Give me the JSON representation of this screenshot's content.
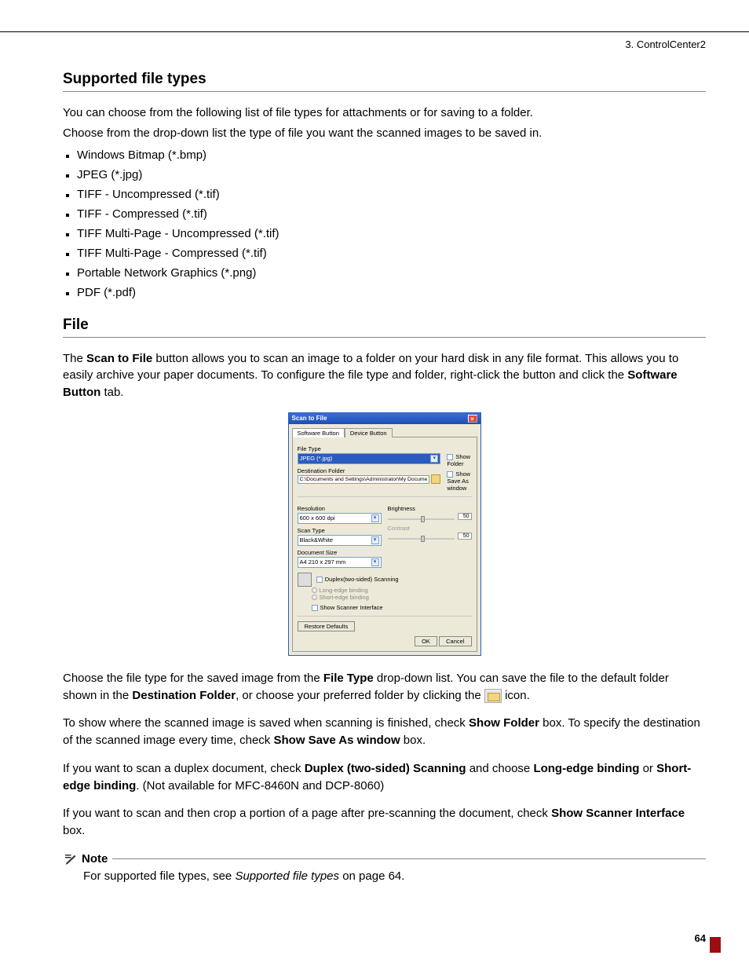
{
  "header": {
    "breadcrumb": "3. ControlCenter2"
  },
  "section1": {
    "title": "Supported file types",
    "intro1": "You can choose from the following list of file types for attachments or for saving to a folder.",
    "intro2": "Choose from the drop-down list the type of file you want the scanned images to be saved in.",
    "types": [
      "Windows Bitmap (*.bmp)",
      "JPEG (*.jpg)",
      "TIFF - Uncompressed (*.tif)",
      "TIFF - Compressed (*.tif)",
      "TIFF Multi-Page - Uncompressed (*.tif)",
      "TIFF Multi-Page - Compressed (*.tif)",
      "Portable Network Graphics (*.png)",
      "PDF (*.pdf)"
    ]
  },
  "section2": {
    "title": "File",
    "p1a": "The ",
    "p1b": "Scan to File",
    "p1c": " button allows you to scan an image to a folder on your hard disk in any file format. This allows you to easily archive your paper documents. To configure the file type and folder, right-click the button and click the ",
    "p1d": "Software Button",
    "p1e": " tab.",
    "p2a": "Choose the file type for the saved image from the ",
    "p2b": "File Type",
    "p2c": " drop-down list. You can save the file to the default folder shown in the ",
    "p2d": "Destination Folder",
    "p2e": ", or choose your preferred folder by clicking the ",
    "p2f": " icon.",
    "p3a": "To show where the scanned image is saved when scanning is finished, check ",
    "p3b": "Show Folder",
    "p3c": " box. To specify the destination of the scanned image every time, check ",
    "p3d": "Show Save As window",
    "p3e": " box.",
    "p4a": "If you want to scan a duplex document, check ",
    "p4b": "Duplex (two-sided) Scanning",
    "p4c": " and choose ",
    "p4d": "Long-edge binding",
    "p4e": " or ",
    "p4f": "Short-edge binding",
    "p4g": ". (Not available for MFC-8460N and DCP-8060)",
    "p5a": "If you want to scan and then crop a portion of a page after pre-scanning the document, check ",
    "p5b": "Show Scanner Interface",
    "p5c": " box."
  },
  "dialog": {
    "title": "Scan to File",
    "tab1": "Software Button",
    "tab2": "Device Button",
    "fileTypeLabel": "File Type",
    "fileType": "JPEG (*.jpg)",
    "destLabel": "Destination Folder",
    "dest": "C:\\Documents and Settings\\Administrator\\My Docume",
    "showFolder": "Show Folder",
    "showSaveAs": "Show Save As window",
    "resLabel": "Resolution",
    "res": "600 x 600 dpi",
    "scanTypeLabel": "Scan Type",
    "scanType": "Black&White",
    "docSizeLabel": "Document Size",
    "docSize": "A4 210 x 297 mm",
    "brightLabel": "Brightness",
    "brightVal": "50",
    "contrastLabel": "Contrast",
    "contrastVal": "50",
    "duplex": "Duplex(two-sided) Scanning",
    "longEdge": "Long-edge binding",
    "shortEdge": "Short-edge binding",
    "showScanner": "Show Scanner Interface",
    "restore": "Restore Defaults",
    "ok": "OK",
    "cancel": "Cancel"
  },
  "note": {
    "label": "Note",
    "t1": "For supported file types, see ",
    "t2": "Supported file types",
    "t3": " on page 64."
  },
  "footer": {
    "page": "64"
  }
}
